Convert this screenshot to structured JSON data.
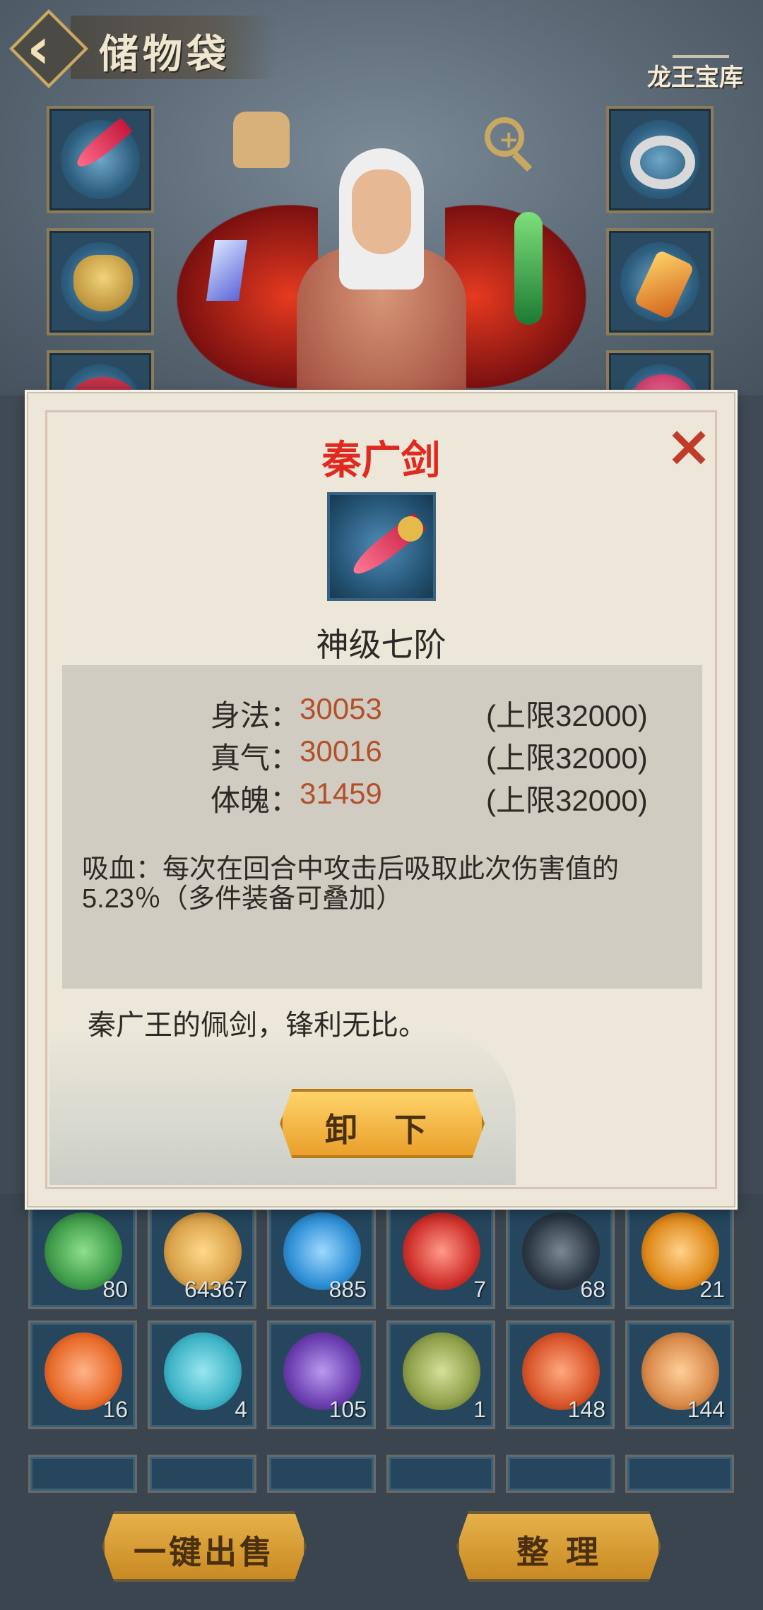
{
  "header": {
    "title": "储物袋",
    "logo_text": "龙王宝库"
  },
  "bag": {
    "row1": [
      {
        "qty": "80",
        "color": "#3f9c4a"
      },
      {
        "qty": "64367",
        "color": "#d9a24a"
      },
      {
        "qty": "885",
        "color": "#2f8fd6"
      },
      {
        "qty": "7",
        "color": "#d0322c"
      },
      {
        "qty": "68",
        "color": "#2d3945"
      },
      {
        "qty": "21",
        "color": "#e08a1c"
      }
    ],
    "row2": [
      {
        "qty": "16",
        "color": "#e86b2a"
      },
      {
        "qty": "4",
        "color": "#3fb5c7"
      },
      {
        "qty": "105",
        "color": "#6b3fb0"
      },
      {
        "qty": "1",
        "color": "#8fa04a"
      },
      {
        "qty": "148",
        "color": "#d9562a"
      },
      {
        "qty": "144",
        "color": "#d98a4a"
      }
    ]
  },
  "buttons": {
    "sell_all": "一键出售",
    "sort": "整 理"
  },
  "dialog": {
    "item_name": "秦广剑",
    "grade": "神级七阶",
    "stats": [
      {
        "label": "身法：",
        "value": "30053",
        "cap": "(上限32000)"
      },
      {
        "label": "真气：",
        "value": "30016",
        "cap": "(上限32000)"
      },
      {
        "label": "体魄：",
        "value": "31459",
        "cap": "(上限32000)"
      }
    ],
    "effect": "吸血：每次在回合中攻击后吸取此次伤害值的5.23％（多件装备可叠加）",
    "flavor": "秦广王的佩剑，锋利无比。",
    "unequip": "卸 下",
    "close_icon": "×"
  },
  "colors": {
    "item_name": "#e02a20",
    "stat_value": "#b2502a",
    "button_gold": "#e9a02a"
  }
}
